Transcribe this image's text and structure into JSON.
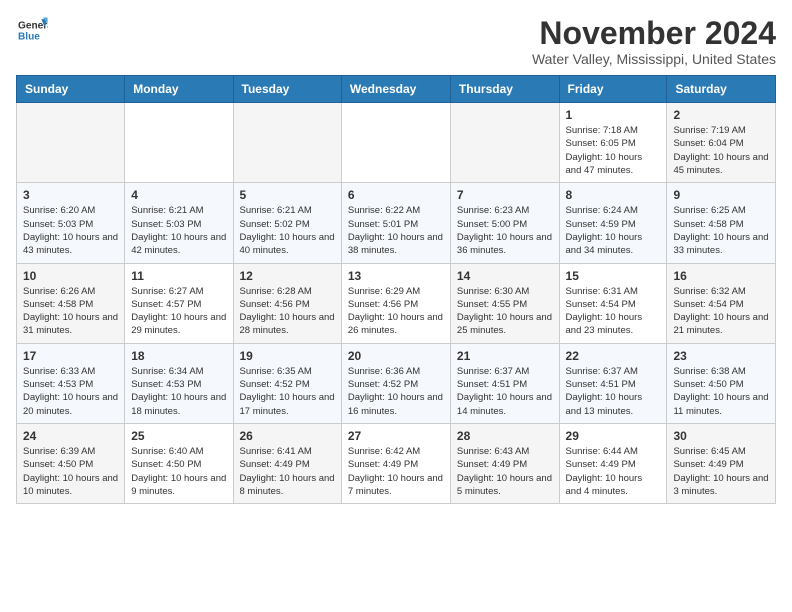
{
  "logo": {
    "line1": "General",
    "line2": "Blue"
  },
  "title": "November 2024",
  "location": "Water Valley, Mississippi, United States",
  "days_of_week": [
    "Sunday",
    "Monday",
    "Tuesday",
    "Wednesday",
    "Thursday",
    "Friday",
    "Saturday"
  ],
  "weeks": [
    [
      {
        "day": "",
        "content": ""
      },
      {
        "day": "",
        "content": ""
      },
      {
        "day": "",
        "content": ""
      },
      {
        "day": "",
        "content": ""
      },
      {
        "day": "",
        "content": ""
      },
      {
        "day": "1",
        "content": "Sunrise: 7:18 AM\nSunset: 6:05 PM\nDaylight: 10 hours and 47 minutes."
      },
      {
        "day": "2",
        "content": "Sunrise: 7:19 AM\nSunset: 6:04 PM\nDaylight: 10 hours and 45 minutes."
      }
    ],
    [
      {
        "day": "3",
        "content": "Sunrise: 6:20 AM\nSunset: 5:03 PM\nDaylight: 10 hours and 43 minutes."
      },
      {
        "day": "4",
        "content": "Sunrise: 6:21 AM\nSunset: 5:03 PM\nDaylight: 10 hours and 42 minutes."
      },
      {
        "day": "5",
        "content": "Sunrise: 6:21 AM\nSunset: 5:02 PM\nDaylight: 10 hours and 40 minutes."
      },
      {
        "day": "6",
        "content": "Sunrise: 6:22 AM\nSunset: 5:01 PM\nDaylight: 10 hours and 38 minutes."
      },
      {
        "day": "7",
        "content": "Sunrise: 6:23 AM\nSunset: 5:00 PM\nDaylight: 10 hours and 36 minutes."
      },
      {
        "day": "8",
        "content": "Sunrise: 6:24 AM\nSunset: 4:59 PM\nDaylight: 10 hours and 34 minutes."
      },
      {
        "day": "9",
        "content": "Sunrise: 6:25 AM\nSunset: 4:58 PM\nDaylight: 10 hours and 33 minutes."
      }
    ],
    [
      {
        "day": "10",
        "content": "Sunrise: 6:26 AM\nSunset: 4:58 PM\nDaylight: 10 hours and 31 minutes."
      },
      {
        "day": "11",
        "content": "Sunrise: 6:27 AM\nSunset: 4:57 PM\nDaylight: 10 hours and 29 minutes."
      },
      {
        "day": "12",
        "content": "Sunrise: 6:28 AM\nSunset: 4:56 PM\nDaylight: 10 hours and 28 minutes."
      },
      {
        "day": "13",
        "content": "Sunrise: 6:29 AM\nSunset: 4:56 PM\nDaylight: 10 hours and 26 minutes."
      },
      {
        "day": "14",
        "content": "Sunrise: 6:30 AM\nSunset: 4:55 PM\nDaylight: 10 hours and 25 minutes."
      },
      {
        "day": "15",
        "content": "Sunrise: 6:31 AM\nSunset: 4:54 PM\nDaylight: 10 hours and 23 minutes."
      },
      {
        "day": "16",
        "content": "Sunrise: 6:32 AM\nSunset: 4:54 PM\nDaylight: 10 hours and 21 minutes."
      }
    ],
    [
      {
        "day": "17",
        "content": "Sunrise: 6:33 AM\nSunset: 4:53 PM\nDaylight: 10 hours and 20 minutes."
      },
      {
        "day": "18",
        "content": "Sunrise: 6:34 AM\nSunset: 4:53 PM\nDaylight: 10 hours and 18 minutes."
      },
      {
        "day": "19",
        "content": "Sunrise: 6:35 AM\nSunset: 4:52 PM\nDaylight: 10 hours and 17 minutes."
      },
      {
        "day": "20",
        "content": "Sunrise: 6:36 AM\nSunset: 4:52 PM\nDaylight: 10 hours and 16 minutes."
      },
      {
        "day": "21",
        "content": "Sunrise: 6:37 AM\nSunset: 4:51 PM\nDaylight: 10 hours and 14 minutes."
      },
      {
        "day": "22",
        "content": "Sunrise: 6:37 AM\nSunset: 4:51 PM\nDaylight: 10 hours and 13 minutes."
      },
      {
        "day": "23",
        "content": "Sunrise: 6:38 AM\nSunset: 4:50 PM\nDaylight: 10 hours and 11 minutes."
      }
    ],
    [
      {
        "day": "24",
        "content": "Sunrise: 6:39 AM\nSunset: 4:50 PM\nDaylight: 10 hours and 10 minutes."
      },
      {
        "day": "25",
        "content": "Sunrise: 6:40 AM\nSunset: 4:50 PM\nDaylight: 10 hours and 9 minutes."
      },
      {
        "day": "26",
        "content": "Sunrise: 6:41 AM\nSunset: 4:49 PM\nDaylight: 10 hours and 8 minutes."
      },
      {
        "day": "27",
        "content": "Sunrise: 6:42 AM\nSunset: 4:49 PM\nDaylight: 10 hours and 7 minutes."
      },
      {
        "day": "28",
        "content": "Sunrise: 6:43 AM\nSunset: 4:49 PM\nDaylight: 10 hours and 5 minutes."
      },
      {
        "day": "29",
        "content": "Sunrise: 6:44 AM\nSunset: 4:49 PM\nDaylight: 10 hours and 4 minutes."
      },
      {
        "day": "30",
        "content": "Sunrise: 6:45 AM\nSunset: 4:49 PM\nDaylight: 10 hours and 3 minutes."
      }
    ]
  ]
}
